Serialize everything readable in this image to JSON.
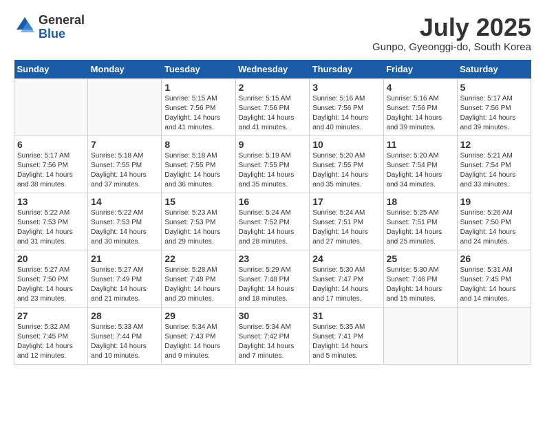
{
  "header": {
    "logo_line1": "General",
    "logo_line2": "Blue",
    "month_title": "July 2025",
    "location": "Gunpo, Gyeonggi-do, South Korea"
  },
  "weekdays": [
    "Sunday",
    "Monday",
    "Tuesday",
    "Wednesday",
    "Thursday",
    "Friday",
    "Saturday"
  ],
  "weeks": [
    [
      {
        "day": "",
        "empty": true
      },
      {
        "day": "",
        "empty": true
      },
      {
        "day": "1",
        "sunrise": "5:15 AM",
        "sunset": "7:56 PM",
        "daylight": "14 hours and 41 minutes."
      },
      {
        "day": "2",
        "sunrise": "5:15 AM",
        "sunset": "7:56 PM",
        "daylight": "14 hours and 41 minutes."
      },
      {
        "day": "3",
        "sunrise": "5:16 AM",
        "sunset": "7:56 PM",
        "daylight": "14 hours and 40 minutes."
      },
      {
        "day": "4",
        "sunrise": "5:16 AM",
        "sunset": "7:56 PM",
        "daylight": "14 hours and 39 minutes."
      },
      {
        "day": "5",
        "sunrise": "5:17 AM",
        "sunset": "7:56 PM",
        "daylight": "14 hours and 39 minutes."
      }
    ],
    [
      {
        "day": "6",
        "sunrise": "5:17 AM",
        "sunset": "7:56 PM",
        "daylight": "14 hours and 38 minutes."
      },
      {
        "day": "7",
        "sunrise": "5:18 AM",
        "sunset": "7:55 PM",
        "daylight": "14 hours and 37 minutes."
      },
      {
        "day": "8",
        "sunrise": "5:18 AM",
        "sunset": "7:55 PM",
        "daylight": "14 hours and 36 minutes."
      },
      {
        "day": "9",
        "sunrise": "5:19 AM",
        "sunset": "7:55 PM",
        "daylight": "14 hours and 35 minutes."
      },
      {
        "day": "10",
        "sunrise": "5:20 AM",
        "sunset": "7:55 PM",
        "daylight": "14 hours and 35 minutes."
      },
      {
        "day": "11",
        "sunrise": "5:20 AM",
        "sunset": "7:54 PM",
        "daylight": "14 hours and 34 minutes."
      },
      {
        "day": "12",
        "sunrise": "5:21 AM",
        "sunset": "7:54 PM",
        "daylight": "14 hours and 33 minutes."
      }
    ],
    [
      {
        "day": "13",
        "sunrise": "5:22 AM",
        "sunset": "7:53 PM",
        "daylight": "14 hours and 31 minutes."
      },
      {
        "day": "14",
        "sunrise": "5:22 AM",
        "sunset": "7:53 PM",
        "daylight": "14 hours and 30 minutes."
      },
      {
        "day": "15",
        "sunrise": "5:23 AM",
        "sunset": "7:53 PM",
        "daylight": "14 hours and 29 minutes."
      },
      {
        "day": "16",
        "sunrise": "5:24 AM",
        "sunset": "7:52 PM",
        "daylight": "14 hours and 28 minutes."
      },
      {
        "day": "17",
        "sunrise": "5:24 AM",
        "sunset": "7:51 PM",
        "daylight": "14 hours and 27 minutes."
      },
      {
        "day": "18",
        "sunrise": "5:25 AM",
        "sunset": "7:51 PM",
        "daylight": "14 hours and 25 minutes."
      },
      {
        "day": "19",
        "sunrise": "5:26 AM",
        "sunset": "7:50 PM",
        "daylight": "14 hours and 24 minutes."
      }
    ],
    [
      {
        "day": "20",
        "sunrise": "5:27 AM",
        "sunset": "7:50 PM",
        "daylight": "14 hours and 23 minutes."
      },
      {
        "day": "21",
        "sunrise": "5:27 AM",
        "sunset": "7:49 PM",
        "daylight": "14 hours and 21 minutes."
      },
      {
        "day": "22",
        "sunrise": "5:28 AM",
        "sunset": "7:48 PM",
        "daylight": "14 hours and 20 minutes."
      },
      {
        "day": "23",
        "sunrise": "5:29 AM",
        "sunset": "7:48 PM",
        "daylight": "14 hours and 18 minutes."
      },
      {
        "day": "24",
        "sunrise": "5:30 AM",
        "sunset": "7:47 PM",
        "daylight": "14 hours and 17 minutes."
      },
      {
        "day": "25",
        "sunrise": "5:30 AM",
        "sunset": "7:46 PM",
        "daylight": "14 hours and 15 minutes."
      },
      {
        "day": "26",
        "sunrise": "5:31 AM",
        "sunset": "7:45 PM",
        "daylight": "14 hours and 14 minutes."
      }
    ],
    [
      {
        "day": "27",
        "sunrise": "5:32 AM",
        "sunset": "7:45 PM",
        "daylight": "14 hours and 12 minutes."
      },
      {
        "day": "28",
        "sunrise": "5:33 AM",
        "sunset": "7:44 PM",
        "daylight": "14 hours and 10 minutes."
      },
      {
        "day": "29",
        "sunrise": "5:34 AM",
        "sunset": "7:43 PM",
        "daylight": "14 hours and 9 minutes."
      },
      {
        "day": "30",
        "sunrise": "5:34 AM",
        "sunset": "7:42 PM",
        "daylight": "14 hours and 7 minutes."
      },
      {
        "day": "31",
        "sunrise": "5:35 AM",
        "sunset": "7:41 PM",
        "daylight": "14 hours and 5 minutes."
      },
      {
        "day": "",
        "empty": true
      },
      {
        "day": "",
        "empty": true
      }
    ]
  ]
}
